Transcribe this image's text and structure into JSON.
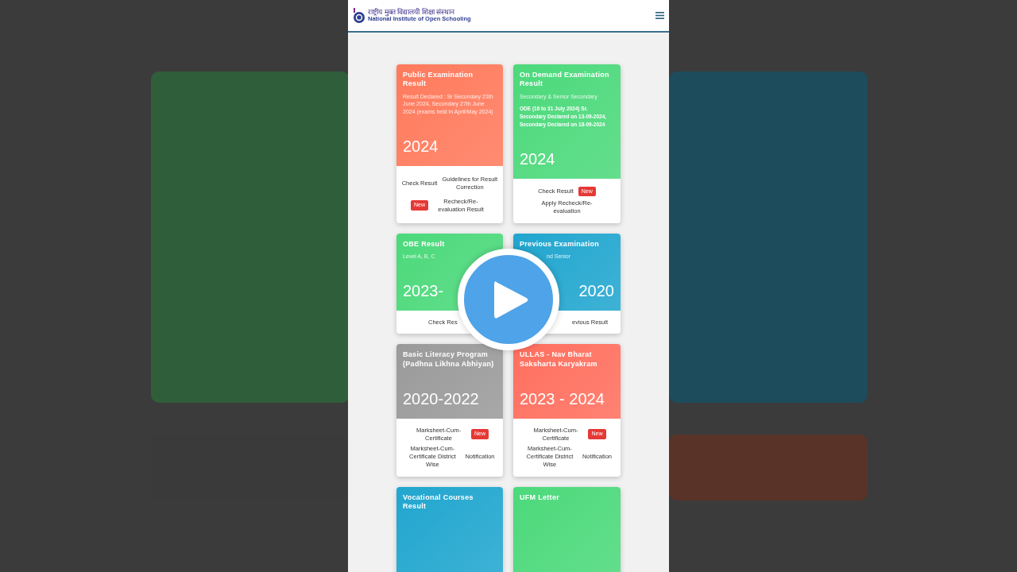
{
  "header": {
    "logo_hindi": "राष्ट्रीय मुक्त विद्यालयी शिक्षा संस्थान",
    "logo_english": "National Institute of Open Schooling"
  },
  "cards": [
    {
      "title": "Public Examination Result",
      "subtitle": "Result Declared : Sr Secondary 21th June 2024, Secondary 27th June 2024 (exams held in April/May 2024)",
      "year": "2024",
      "color": "#ff7a5c",
      "links": [
        {
          "kind": "link",
          "label": "Check Result"
        },
        {
          "kind": "link",
          "label": "Guidelines for Result Correction"
        },
        {
          "kind": "badge",
          "label": "New"
        },
        {
          "kind": "link",
          "label": "Recheck/Re-evaluation Result"
        }
      ]
    },
    {
      "title": "On Demand Examination Result",
      "subtitle": "Secondary & Senior Secondary",
      "note": "ODE (16 to 31 July 2024) Sr. Secondary Declared on 13-09-2024, Secondary Declared on 18-09-2024",
      "year": "2024",
      "color": "#4cd97b",
      "links": [
        {
          "kind": "link",
          "label": "Check Result"
        },
        {
          "kind": "badge",
          "label": "New"
        },
        {
          "kind": "link",
          "label": "Apply Recheck/Re-evaluation"
        }
      ]
    },
    {
      "title": "OBE Result",
      "subtitle": "Level A, B, C",
      "year": "2023-",
      "color": "#4cd97b",
      "links": [
        {
          "kind": "link",
          "label": "Check Res"
        }
      ]
    },
    {
      "title": "Previous Examination",
      "subtitle": "nd Senior",
      "year": "2020",
      "color": "#21a6cf",
      "links": [
        {
          "kind": "link",
          "label": "evious Result"
        }
      ]
    },
    {
      "title": "Basic Literacy Program (Padhna Likhna Abhiyan)",
      "year": "2020-2022",
      "color": "#9a9a9a",
      "links": [
        {
          "kind": "link",
          "label": "Marksheet-Cum-Certificate"
        },
        {
          "kind": "badge",
          "label": "New"
        },
        {
          "kind": "link",
          "label": "Marksheet-Cum-Certificate District Wise"
        },
        {
          "kind": "link",
          "label": "Notification"
        }
      ]
    },
    {
      "title": "ULLAS - Nav Bharat Saksharta Karyakram",
      "year": "2023 - 2024",
      "color": "#ff6f5e",
      "links": [
        {
          "kind": "link",
          "label": "Marksheet-Cum-Certificate"
        },
        {
          "kind": "badge",
          "label": "New"
        },
        {
          "kind": "link",
          "label": "Marksheet-Cum-Certificate District Wise"
        },
        {
          "kind": "link",
          "label": "Notification"
        }
      ]
    },
    {
      "title": "Vocational Courses Result",
      "color": "#21a6cf"
    },
    {
      "title": "UFM Letter",
      "color": "#4cd97b"
    }
  ]
}
